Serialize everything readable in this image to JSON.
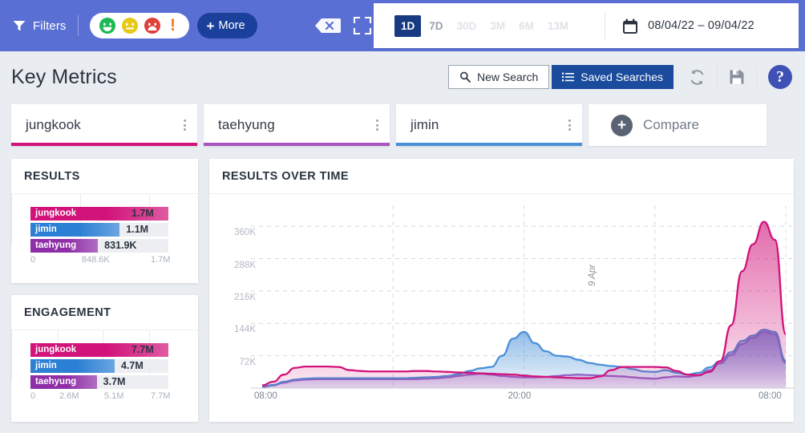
{
  "topbar": {
    "filters_label": "Filters",
    "funnel_icon": "funnel-icon",
    "sentiment_chips": [
      {
        "name": "positive",
        "icon": "smiley-happy-icon",
        "color": "#1db954"
      },
      {
        "name": "neutral",
        "icon": "smiley-neutral-icon",
        "color": "#e8c818"
      },
      {
        "name": "negative",
        "icon": "smiley-sad-icon",
        "color": "#e0403c"
      },
      {
        "name": "alert",
        "icon": "exclamation-icon",
        "color": "#f07c17"
      }
    ],
    "more_label": "More",
    "more_plus": "+",
    "clear_icon": "clear-tag-x-icon",
    "fullscreen_icon": "fullscreen-expand-icon",
    "bg_color": "#5a6fd4"
  },
  "period": {
    "options": [
      "1D",
      "7D",
      "30D",
      "3M",
      "6M",
      "13M"
    ],
    "selected": "1D",
    "calendar_icon": "calendar-icon",
    "date_range": "08/04/22 – 09/04/22"
  },
  "header": {
    "title": "Key Metrics",
    "new_search_label": "New Search",
    "new_search_icon": "magnifier-icon",
    "saved_searches_label": "Saved Searches",
    "saved_searches_icon": "list-lines-icon",
    "refresh_icon": "refresh-circular-arrows-icon",
    "save_icon": "floppy-disk-save-icon",
    "help_icon": "question-mark-icon",
    "help_label": "?",
    "accent_color": "#1b4b9c"
  },
  "tabs": [
    {
      "label": "jungkook",
      "color": "#d1137a",
      "kebab_icon": "kebab-menu-icon"
    },
    {
      "label": "taehyung",
      "color": "#a855c0",
      "kebab_icon": "kebab-menu-icon"
    },
    {
      "label": "jimin",
      "color": "#4a90d9",
      "kebab_icon": "kebab-menu-icon"
    }
  ],
  "compare": {
    "label": "Compare",
    "plus": "+",
    "icon": "plus-circle-icon"
  },
  "panels": {
    "results_title": "RESULTS",
    "engagement_title": "ENGAGEMENT",
    "rot_title": "RESULTS OVER TIME"
  },
  "chart_data": [
    {
      "type": "bar",
      "title": "RESULTS",
      "orientation": "horizontal",
      "categories": [
        "jungkook",
        "jimin",
        "taehyung"
      ],
      "values": [
        1700000,
        1100000,
        831900
      ],
      "value_labels": [
        "1.7M",
        "1.1M",
        "831.9K"
      ],
      "colors": [
        "#d1137a",
        "#2b7fd4",
        "#8f2fa8"
      ],
      "xlim": [
        0,
        1700000
      ],
      "tick_labels": [
        "0",
        "848.6K",
        "1.7M"
      ],
      "tick_values": [
        0,
        848600,
        1700000
      ],
      "grid": true,
      "xlabel": "",
      "ylabel": ""
    },
    {
      "type": "bar",
      "title": "ENGAGEMENT",
      "orientation": "horizontal",
      "categories": [
        "jungkook",
        "jimin",
        "taehyung"
      ],
      "values": [
        7700000,
        4700000,
        3700000
      ],
      "value_labels": [
        "7.7M",
        "4.7M",
        "3.7M"
      ],
      "colors": [
        "#d1137a",
        "#2b7fd4",
        "#8f2fa8"
      ],
      "xlim": [
        0,
        7700000
      ],
      "tick_labels": [
        "0",
        "2.6M",
        "5.1M",
        "7.7M"
      ],
      "tick_values": [
        0,
        2600000,
        5100000,
        7700000
      ],
      "grid": true,
      "xlabel": "",
      "ylabel": ""
    },
    {
      "type": "area",
      "title": "RESULTS OVER TIME",
      "ylim": [
        0,
        396000
      ],
      "ytick_labels": [
        "72K",
        "144K",
        "216K",
        "288K",
        "360K"
      ],
      "ytick_values": [
        72000,
        144000,
        216000,
        288000,
        360000
      ],
      "xtick_labels": [
        "08:00",
        "20:00",
        "08:00"
      ],
      "annotations": [
        "9 Apr"
      ],
      "grid": true,
      "grid_style": "dashed",
      "legend_position": "none",
      "x": [
        0,
        1,
        2,
        3,
        4,
        5,
        6,
        7,
        8,
        9,
        10,
        11,
        12,
        13,
        14,
        15,
        16,
        17,
        18,
        19,
        20,
        21,
        22,
        23,
        24,
        25,
        26,
        27,
        28,
        29,
        30,
        31,
        32,
        33,
        34,
        35,
        36,
        37,
        38,
        39,
        40,
        41,
        42,
        43,
        44,
        45,
        46,
        47,
        48
      ],
      "series": [
        {
          "name": "jungkook",
          "color": "#d1137a",
          "values": [
            6000,
            14000,
            30000,
            45000,
            48000,
            48000,
            48000,
            47000,
            40000,
            38000,
            37000,
            37000,
            37000,
            37000,
            38000,
            38000,
            37000,
            36000,
            35000,
            34000,
            33000,
            32000,
            31000,
            30000,
            28000,
            26000,
            25000,
            24000,
            23000,
            22000,
            22000,
            26000,
            40000,
            47000,
            47000,
            47000,
            47000,
            46000,
            38000,
            30000,
            29000,
            36000,
            60000,
            140000,
            260000,
            320000,
            370000,
            330000,
            120000
          ]
        },
        {
          "name": "jimin",
          "color": "#4a90d9",
          "values": [
            3000,
            7000,
            14000,
            19000,
            21000,
            22000,
            22000,
            22000,
            22000,
            22000,
            22000,
            22000,
            22000,
            22000,
            23000,
            24000,
            25000,
            27000,
            31000,
            38000,
            44000,
            47000,
            72000,
            110000,
            125000,
            100000,
            82000,
            72000,
            70000,
            63000,
            56000,
            52000,
            49000,
            47000,
            42000,
            37000,
            36000,
            40000,
            34000,
            30000,
            34000,
            46000,
            60000,
            80000,
            105000,
            117000,
            130000,
            125000,
            60000
          ]
        },
        {
          "name": "taehyung",
          "color": "#a855c0",
          "values": [
            2500,
            6000,
            12000,
            17000,
            19000,
            20000,
            20000,
            20000,
            20000,
            20000,
            20000,
            20000,
            20000,
            20000,
            20000,
            21000,
            22000,
            24000,
            27000,
            30000,
            32000,
            30000,
            27000,
            25000,
            24000,
            24000,
            25000,
            27000,
            29000,
            30000,
            29000,
            28000,
            27000,
            26000,
            24000,
            22000,
            21000,
            24000,
            26000,
            25000,
            28000,
            40000,
            55000,
            74000,
            98000,
            112000,
            125000,
            120000,
            56000
          ]
        }
      ]
    }
  ]
}
